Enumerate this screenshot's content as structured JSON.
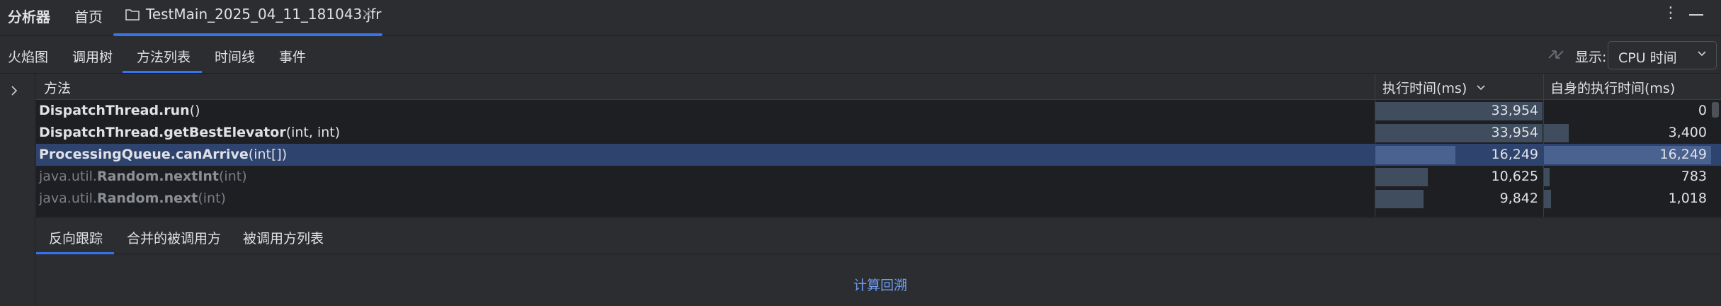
{
  "header": {
    "app_title": "分析器",
    "home_tab": "首页",
    "file_tab": "TestMain_2025_04_11_181043.jfr",
    "close_glyph": "×",
    "more_glyph": "⋮"
  },
  "subtabs": {
    "items": [
      "火焰图",
      "调用树",
      "方法列表",
      "时间线",
      "事件"
    ],
    "active_index": 2,
    "display_label": "显示:",
    "display_value": "CPU 时间"
  },
  "table": {
    "columns": {
      "method": "方法",
      "exec_time": "执行时间(ms)",
      "self_time": "自身的执行时间(ms)"
    },
    "max_value": 33954,
    "rows": [
      {
        "pkg": "",
        "cls": "DispatchThread.run",
        "sig": "()",
        "exec_time": "33,954",
        "exec_value": 33954,
        "self_time": "0",
        "self_value": 0,
        "dim": false,
        "selected": false
      },
      {
        "pkg": "",
        "cls": "DispatchThread.getBestElevator",
        "sig": "(int, int)",
        "exec_time": "33,954",
        "exec_value": 33954,
        "self_time": "3,400",
        "self_value": 3400,
        "dim": false,
        "selected": false
      },
      {
        "pkg": "",
        "cls": "ProcessingQueue.canArrive",
        "sig": "(int[])",
        "exec_time": "16,249",
        "exec_value": 16249,
        "self_time": "16,249",
        "self_value": 16249,
        "dim": false,
        "selected": true
      },
      {
        "pkg": "java.util.",
        "cls": "Random.nextInt",
        "sig": "(int)",
        "exec_time": "10,625",
        "exec_value": 10625,
        "self_time": "783",
        "self_value": 783,
        "dim": true,
        "selected": false
      },
      {
        "pkg": "java.util.",
        "cls": "Random.next",
        "sig": "(int)",
        "exec_time": "9,842",
        "exec_value": 9842,
        "self_time": "1,018",
        "self_value": 1018,
        "dim": true,
        "selected": false
      }
    ]
  },
  "bottom": {
    "tabs": [
      "反向跟踪",
      "合并的被调用方",
      "被调用方列表"
    ],
    "active_index": 0,
    "compute_link": "计算回溯"
  },
  "colors": {
    "accent": "#3574f0",
    "selection": "#2e436e",
    "link": "#6f9cf0"
  }
}
